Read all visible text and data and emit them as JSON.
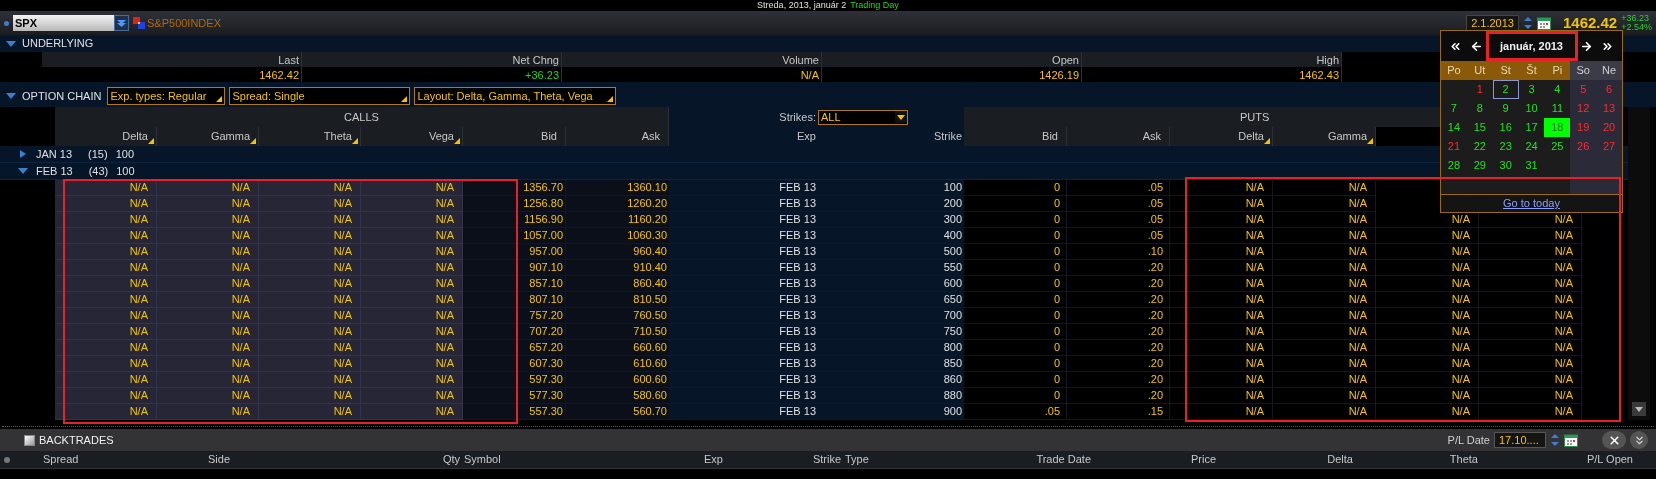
{
  "title_bar": {
    "date": "Streda, 2013, január 2",
    "status": "Trading Day"
  },
  "symbol_bar": {
    "symbol": "SPX",
    "description": "S&P500INDEX",
    "date": "2.1.2013",
    "last": "1462.42",
    "change": "+36.23",
    "change_pct": "+2.54%"
  },
  "underlying": {
    "title": "UNDERLYING",
    "expanded": true,
    "columns": [
      {
        "label": "Last",
        "value": "1462.42",
        "kind": "price"
      },
      {
        "label": "Net Chng",
        "value": "+36.23",
        "kind": "change"
      },
      {
        "label": "Volume",
        "value": "N/A",
        "kind": "price"
      },
      {
        "label": "Open",
        "value": "1426.19",
        "kind": "price"
      },
      {
        "label": "High",
        "value": "1462.43",
        "kind": "price"
      }
    ]
  },
  "option_chain": {
    "title": "OPTION CHAIN",
    "expanded": true,
    "filters": [
      "Exp. types: Regular",
      "Spread: Single",
      "Layout: Delta, Gamma, Theta, Vega"
    ],
    "calls_label": "CALLS",
    "puts_label": "PUTS",
    "strikes_label": "Strikes:",
    "strikes_value": "ALL",
    "call_columns": [
      {
        "label": "Delta",
        "sortable": true
      },
      {
        "label": "Gamma",
        "sortable": true
      },
      {
        "label": "Theta",
        "sortable": true
      },
      {
        "label": "Vega",
        "sortable": true
      },
      {
        "label": "Bid",
        "sortable": false
      },
      {
        "label": "Ask",
        "sortable": false
      }
    ],
    "middle_columns": [
      "Exp",
      "Strike"
    ],
    "put_columns": [
      {
        "label": "Bid",
        "sortable": false
      },
      {
        "label": "Ask",
        "sortable": false
      },
      {
        "label": "Delta",
        "sortable": true
      },
      {
        "label": "Gamma",
        "sortable": true
      }
    ],
    "expirations": [
      {
        "label": "JAN 13",
        "count": "(15)",
        "multiplier": "100",
        "expanded": false
      },
      {
        "label": "FEB 13",
        "count": "(43)",
        "multiplier": "100",
        "expanded": true
      }
    ],
    "rows": [
      {
        "call_greeks": [
          "N/A",
          "N/A",
          "N/A",
          "N/A"
        ],
        "call_bid": "1356.70",
        "call_ask": "1360.10",
        "exp": "FEB 13",
        "strike": "100",
        "put_bid": "0",
        "put_ask": ".05",
        "put_greeks": [
          "N/A",
          "N/A"
        ]
      },
      {
        "call_greeks": [
          "N/A",
          "N/A",
          "N/A",
          "N/A"
        ],
        "call_bid": "1256.80",
        "call_ask": "1260.20",
        "exp": "FEB 13",
        "strike": "200",
        "put_bid": "0",
        "put_ask": ".05",
        "put_greeks": [
          "N/A",
          "N/A"
        ]
      },
      {
        "call_greeks": [
          "N/A",
          "N/A",
          "N/A",
          "N/A"
        ],
        "call_bid": "1156.90",
        "call_ask": "1160.20",
        "exp": "FEB 13",
        "strike": "300",
        "put_bid": "0",
        "put_ask": ".05",
        "put_greeks": [
          "N/A",
          "N/A",
          "N/A",
          "N/A"
        ]
      },
      {
        "call_greeks": [
          "N/A",
          "N/A",
          "N/A",
          "N/A"
        ],
        "call_bid": "1057.00",
        "call_ask": "1060.30",
        "exp": "FEB 13",
        "strike": "400",
        "put_bid": "0",
        "put_ask": ".05",
        "put_greeks": [
          "N/A",
          "N/A",
          "N/A",
          "N/A"
        ]
      },
      {
        "call_greeks": [
          "N/A",
          "N/A",
          "N/A",
          "N/A"
        ],
        "call_bid": "957.00",
        "call_ask": "960.40",
        "exp": "FEB 13",
        "strike": "500",
        "put_bid": "0",
        "put_ask": ".10",
        "put_greeks": [
          "N/A",
          "N/A",
          "N/A",
          "N/A"
        ]
      },
      {
        "call_greeks": [
          "N/A",
          "N/A",
          "N/A",
          "N/A"
        ],
        "call_bid": "907.10",
        "call_ask": "910.40",
        "exp": "FEB 13",
        "strike": "550",
        "put_bid": "0",
        "put_ask": ".20",
        "put_greeks": [
          "N/A",
          "N/A",
          "N/A",
          "N/A"
        ]
      },
      {
        "call_greeks": [
          "N/A",
          "N/A",
          "N/A",
          "N/A"
        ],
        "call_bid": "857.10",
        "call_ask": "860.40",
        "exp": "FEB 13",
        "strike": "600",
        "put_bid": "0",
        "put_ask": ".20",
        "put_greeks": [
          "N/A",
          "N/A",
          "N/A",
          "N/A"
        ]
      },
      {
        "call_greeks": [
          "N/A",
          "N/A",
          "N/A",
          "N/A"
        ],
        "call_bid": "807.10",
        "call_ask": "810.50",
        "exp": "FEB 13",
        "strike": "650",
        "put_bid": "0",
        "put_ask": ".20",
        "put_greeks": [
          "N/A",
          "N/A",
          "N/A",
          "N/A"
        ]
      },
      {
        "call_greeks": [
          "N/A",
          "N/A",
          "N/A",
          "N/A"
        ],
        "call_bid": "757.20",
        "call_ask": "760.50",
        "exp": "FEB 13",
        "strike": "700",
        "put_bid": "0",
        "put_ask": ".20",
        "put_greeks": [
          "N/A",
          "N/A",
          "N/A",
          "N/A"
        ]
      },
      {
        "call_greeks": [
          "N/A",
          "N/A",
          "N/A",
          "N/A"
        ],
        "call_bid": "707.20",
        "call_ask": "710.50",
        "exp": "FEB 13",
        "strike": "750",
        "put_bid": "0",
        "put_ask": ".20",
        "put_greeks": [
          "N/A",
          "N/A",
          "N/A",
          "N/A"
        ]
      },
      {
        "call_greeks": [
          "N/A",
          "N/A",
          "N/A",
          "N/A"
        ],
        "call_bid": "657.20",
        "call_ask": "660.60",
        "exp": "FEB 13",
        "strike": "800",
        "put_bid": "0",
        "put_ask": ".20",
        "put_greeks": [
          "N/A",
          "N/A",
          "N/A",
          "N/A"
        ]
      },
      {
        "call_greeks": [
          "N/A",
          "N/A",
          "N/A",
          "N/A"
        ],
        "call_bid": "607.30",
        "call_ask": "610.60",
        "exp": "FEB 13",
        "strike": "850",
        "put_bid": "0",
        "put_ask": ".20",
        "put_greeks": [
          "N/A",
          "N/A",
          "N/A",
          "N/A"
        ]
      },
      {
        "call_greeks": [
          "N/A",
          "N/A",
          "N/A",
          "N/A"
        ],
        "call_bid": "597.30",
        "call_ask": "600.60",
        "exp": "FEB 13",
        "strike": "860",
        "put_bid": "0",
        "put_ask": ".20",
        "put_greeks": [
          "N/A",
          "N/A",
          "N/A",
          "N/A"
        ]
      },
      {
        "call_greeks": [
          "N/A",
          "N/A",
          "N/A",
          "N/A"
        ],
        "call_bid": "577.30",
        "call_ask": "580.60",
        "exp": "FEB 13",
        "strike": "880",
        "put_bid": "0",
        "put_ask": ".20",
        "put_greeks": [
          "N/A",
          "N/A",
          "N/A",
          "N/A"
        ]
      },
      {
        "call_greeks": [
          "N/A",
          "N/A",
          "N/A",
          "N/A"
        ],
        "call_bid": "557.30",
        "call_ask": "560.70",
        "exp": "FEB 13",
        "strike": "900",
        "put_bid": ".05",
        "put_ask": ".15",
        "put_greeks": [
          "N/A",
          "N/A",
          "N/A",
          "N/A"
        ]
      }
    ]
  },
  "calendar": {
    "month": "január, 2013",
    "footer": "Go to today",
    "weekdays": [
      {
        "label": "Po",
        "weekend": false
      },
      {
        "label": "Ut",
        "weekend": false
      },
      {
        "label": "St",
        "weekend": false
      },
      {
        "label": "Št",
        "weekend": false
      },
      {
        "label": "Pi",
        "weekend": false
      },
      {
        "label": "So",
        "weekend": true
      },
      {
        "label": "Ne",
        "weekend": true
      }
    ],
    "weeks": [
      [
        {
          "kind": "blank"
        },
        {
          "kind": "day",
          "day": "1",
          "holiday": true,
          "selected": false,
          "highlighted": false
        },
        {
          "kind": "day",
          "day": "2",
          "holiday": false,
          "selected": true,
          "highlighted": false
        },
        {
          "kind": "day",
          "day": "3",
          "holiday": false,
          "selected": false,
          "highlighted": false
        },
        {
          "kind": "day",
          "day": "4",
          "holiday": false,
          "selected": false,
          "highlighted": false
        },
        {
          "kind": "day",
          "day": "5",
          "holiday": true,
          "selected": false,
          "highlighted": false
        },
        {
          "kind": "day",
          "day": "6",
          "holiday": true,
          "selected": false,
          "highlighted": false
        }
      ],
      [
        {
          "kind": "day",
          "day": "7",
          "holiday": false,
          "selected": false,
          "highlighted": false
        },
        {
          "kind": "day",
          "day": "8",
          "holiday": false,
          "selected": false,
          "highlighted": false
        },
        {
          "kind": "day",
          "day": "9",
          "holiday": false,
          "selected": false,
          "highlighted": false
        },
        {
          "kind": "day",
          "day": "10",
          "holiday": false,
          "selected": false,
          "highlighted": false
        },
        {
          "kind": "day",
          "day": "11",
          "holiday": false,
          "selected": false,
          "highlighted": false
        },
        {
          "kind": "day",
          "day": "12",
          "holiday": true,
          "selected": false,
          "highlighted": false
        },
        {
          "kind": "day",
          "day": "13",
          "holiday": true,
          "selected": false,
          "highlighted": false
        }
      ],
      [
        {
          "kind": "day",
          "day": "14",
          "holiday": false,
          "selected": false,
          "highlighted": false
        },
        {
          "kind": "day",
          "day": "15",
          "holiday": false,
          "selected": false,
          "highlighted": false
        },
        {
          "kind": "day",
          "day": "16",
          "holiday": false,
          "selected": false,
          "highlighted": false
        },
        {
          "kind": "day",
          "day": "17",
          "holiday": false,
          "selected": false,
          "highlighted": false
        },
        {
          "kind": "day",
          "day": "18",
          "holiday": false,
          "selected": false,
          "highlighted": true
        },
        {
          "kind": "day",
          "day": "19",
          "holiday": true,
          "selected": false,
          "highlighted": false
        },
        {
          "kind": "day",
          "day": "20",
          "holiday": true,
          "selected": false,
          "highlighted": false
        }
      ],
      [
        {
          "kind": "day",
          "day": "21",
          "holiday": true,
          "selected": false,
          "highlighted": false
        },
        {
          "kind": "day",
          "day": "22",
          "holiday": false,
          "selected": false,
          "highlighted": false
        },
        {
          "kind": "day",
          "day": "23",
          "holiday": false,
          "selected": false,
          "highlighted": false
        },
        {
          "kind": "day",
          "day": "24",
          "holiday": false,
          "selected": false,
          "highlighted": false
        },
        {
          "kind": "day",
          "day": "25",
          "holiday": false,
          "selected": false,
          "highlighted": false
        },
        {
          "kind": "day",
          "day": "26",
          "holiday": true,
          "selected": false,
          "highlighted": false
        },
        {
          "kind": "day",
          "day": "27",
          "holiday": true,
          "selected": false,
          "highlighted": false
        }
      ],
      [
        {
          "kind": "day",
          "day": "28",
          "holiday": false,
          "selected": false,
          "highlighted": false
        },
        {
          "kind": "day",
          "day": "29",
          "holiday": false,
          "selected": false,
          "highlighted": false
        },
        {
          "kind": "day",
          "day": "30",
          "holiday": false,
          "selected": false,
          "highlighted": false
        },
        {
          "kind": "day",
          "day": "31",
          "holiday": false,
          "selected": false,
          "highlighted": false
        },
        {
          "kind": "blank"
        },
        {
          "kind": "blank"
        },
        {
          "kind": "blank"
        }
      ]
    ]
  },
  "backtrades": {
    "title": "BACKTRADES",
    "checked": false,
    "pl_date_label": "P/L Date",
    "pl_date": "17.10....",
    "columns": [
      "Spread",
      "Side",
      "Qty",
      "Symbol",
      "Exp",
      "Strike",
      "Type",
      "Trade Date",
      "Price",
      "Delta",
      "Theta",
      "P/L Open"
    ]
  }
}
